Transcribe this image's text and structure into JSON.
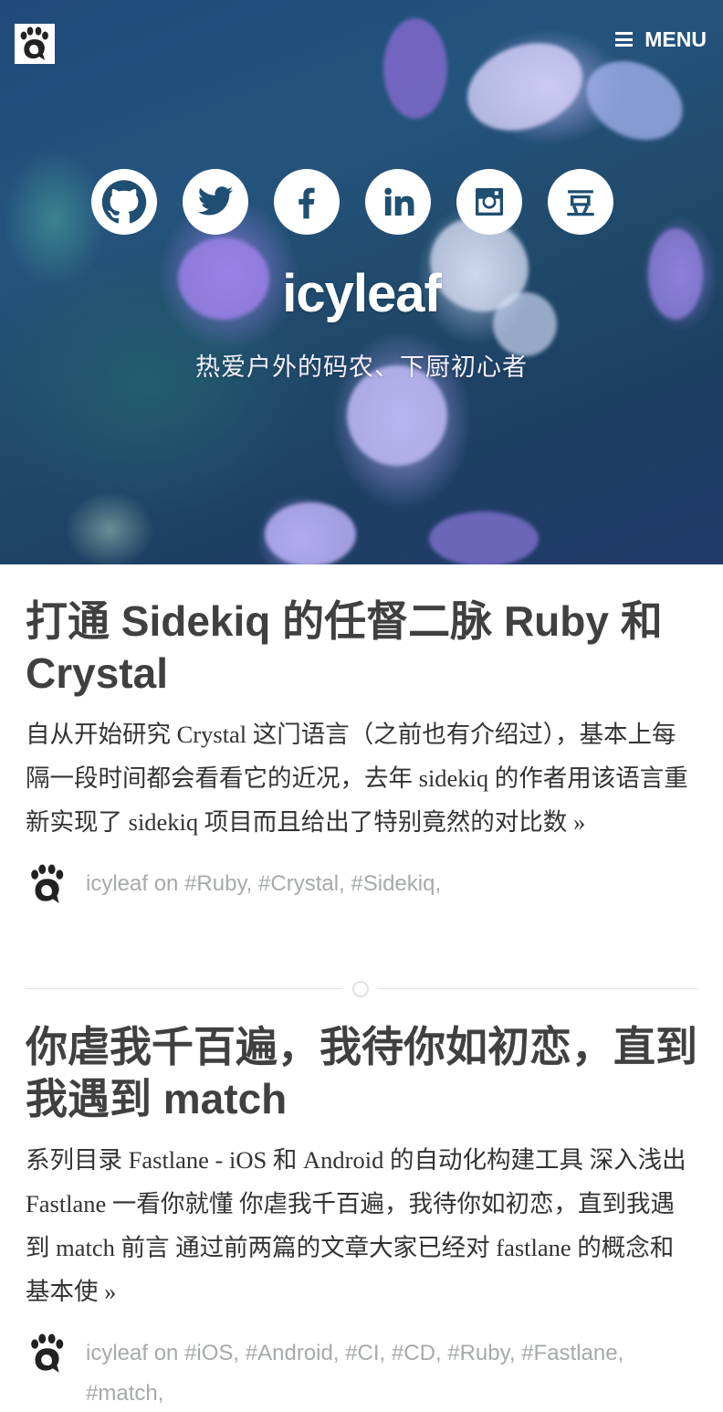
{
  "header": {
    "logo_icon": "paw-q-logo-icon",
    "menu_label": "MENU",
    "menu_icon": "hamburger-icon"
  },
  "hero": {
    "title": "icyleaf",
    "subtitle": "热爱户外的码农、下厨初心者",
    "socials": [
      {
        "name": "github",
        "icon": "github-icon"
      },
      {
        "name": "twitter",
        "icon": "twitter-icon"
      },
      {
        "name": "facebook",
        "icon": "facebook-icon"
      },
      {
        "name": "linkedin",
        "icon": "linkedin-icon"
      },
      {
        "name": "instagram",
        "icon": "instagram-icon"
      },
      {
        "name": "douban",
        "icon": "douban-icon",
        "glyph": "豆"
      }
    ],
    "icon_color": "#1f4f72"
  },
  "posts": [
    {
      "title": "打通 Sidekiq 的任督二脉 Ruby 和 Crystal",
      "excerpt": "自从开始研究 Crystal 这门语言（之前也有介绍过），基本上每隔一段时间都会看看它的近况，去年 sidekiq 的作者用该语言重新实现了 sidekiq 项目而且给出了特别竟然的对比数",
      "more": "»",
      "author": "icyleaf",
      "on": "on",
      "tags": [
        "#Ruby,",
        "#Crystal,",
        "#Sidekiq,"
      ]
    },
    {
      "title": "你虐我千百遍，我待你如初恋，直到我遇到 match",
      "excerpt": "系列目录 Fastlane - iOS 和 Android 的自动化构建工具 深入浅出 Fastlane 一看你就懂 你虐我千百遍，我待你如初恋，直到我遇到 match 前言 通过前两篇的文章大家已经对 fastlane 的概念和基本使",
      "more": "»",
      "author": "icyleaf",
      "on": "on",
      "tags": [
        "#iOS,",
        "#Android,",
        "#CI,",
        "#CD,",
        "#Ruby,",
        "#Fastlane,",
        "#match,"
      ]
    }
  ],
  "colors": {
    "title": "#404040",
    "text": "#333333",
    "meta": "#a6a9ad",
    "divider": "#dfe1e3"
  }
}
